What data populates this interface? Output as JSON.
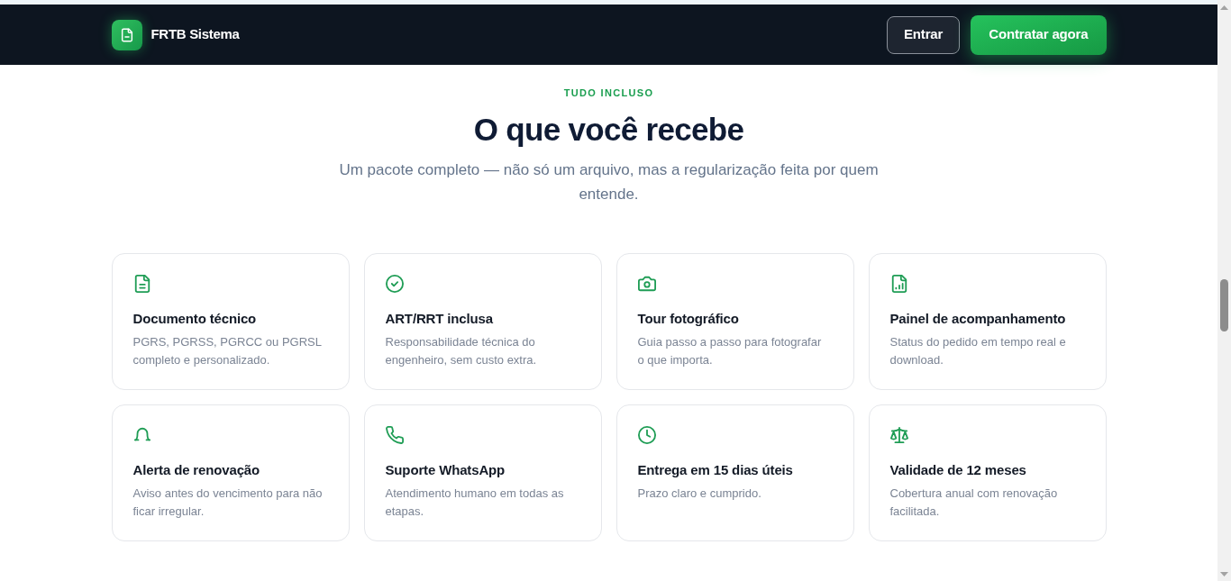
{
  "header": {
    "logo_text": "FRTB Sistema",
    "buttons": [
      {
        "label": "Entrar",
        "kind": "outline"
      },
      {
        "label": "Contratar agora",
        "kind": "primary"
      }
    ]
  },
  "section": {
    "eyebrow": "TUDO INCLUSO",
    "title": "O que você recebe",
    "subtitle": "Um pacote completo — não só um arquivo, mas a regularização feita por quem entende."
  },
  "features": [
    {
      "kind": "document",
      "title": "Documento técnico",
      "description": "PGRS, PGRSS, PGRCC ou PGRSL completo e personalizado."
    },
    {
      "kind": "check",
      "title": "ART/RRT inclusa",
      "description": "Responsabilidade técnica do engenheiro, sem custo extra."
    },
    {
      "kind": "camera",
      "title": "Tour fotográfico",
      "description": "Guia passo a passo para fotografar o que importa."
    },
    {
      "kind": "chart",
      "title": "Painel de acompanhamento",
      "description": "Status do pedido em tempo real e download."
    },
    {
      "kind": "bell",
      "title": "Alerta de renovação",
      "description": "Aviso antes do vencimento para não ficar irregular."
    },
    {
      "kind": "phone",
      "title": "Suporte WhatsApp",
      "description": "Atendimento humano em todas as etapas."
    },
    {
      "kind": "clock",
      "title": "Entrega em 15 dias úteis",
      "description": "Prazo claro e cumprido."
    },
    {
      "kind": "scale",
      "title": "Validade de 12 meses",
      "description": "Cobertura anual com renovação facilitada."
    }
  ]
}
